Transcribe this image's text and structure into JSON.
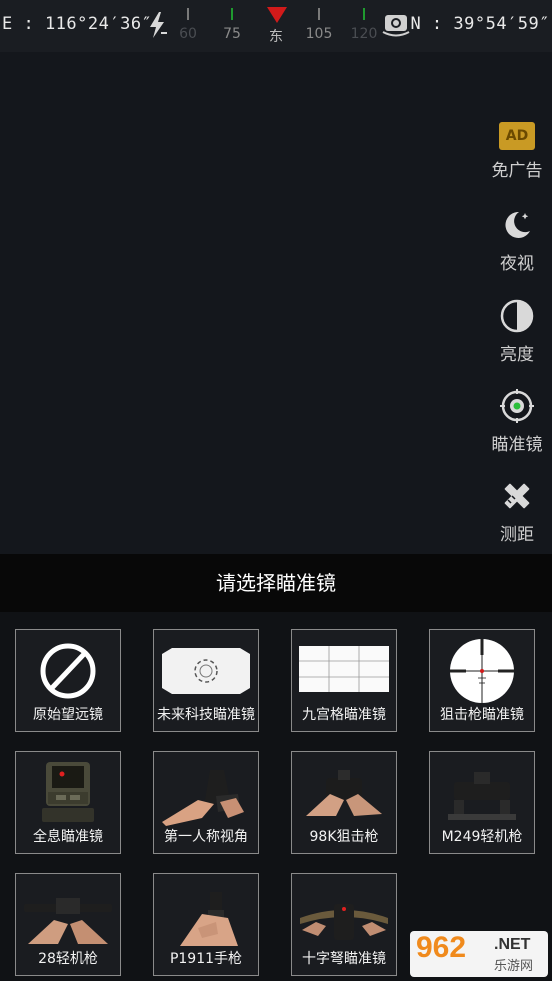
{
  "hud": {
    "longitude": "E : 116°24′36″",
    "latitude": "N : 39°54′59″",
    "compass": {
      "labels": [
        "60",
        "75",
        "东",
        "105",
        "120"
      ],
      "heading_label": "东"
    }
  },
  "sidebar": {
    "items": [
      {
        "label": "免广告",
        "icon": "ad-badge-icon",
        "badge": "AD"
      },
      {
        "label": "夜视",
        "icon": "moon-icon"
      },
      {
        "label": "亮度",
        "icon": "brightness-icon"
      },
      {
        "label": "瞄准镜",
        "icon": "crosshair-icon"
      },
      {
        "label": "测距",
        "icon": "ruler-pencil-icon"
      }
    ]
  },
  "scope_panel": {
    "title": "请选择瞄准镜",
    "options": [
      {
        "label": "原始望远镜",
        "thumb": "no-scope-icon"
      },
      {
        "label": "未来科技瞄准镜",
        "thumb": "futuristic-scope"
      },
      {
        "label": "九宫格瞄准镜",
        "thumb": "grid-scope"
      },
      {
        "label": "狙击枪瞄准镜",
        "thumb": "sniper-scope"
      },
      {
        "label": "全息瞄准镜",
        "thumb": "holographic-sight"
      },
      {
        "label": "第一人称视角",
        "thumb": "first-person-view"
      },
      {
        "label": "98K狙击枪",
        "thumb": "98k-rifle"
      },
      {
        "label": "M249轻机枪",
        "thumb": "m249-lmg"
      },
      {
        "label": "28轻机枪",
        "thumb": "28-lmg"
      },
      {
        "label": "P1911手枪",
        "thumb": "p1911-pistol"
      },
      {
        "label": "十字弩瞄准镜",
        "thumb": "crossbow-scope"
      }
    ]
  },
  "watermark": {
    "number": "962",
    "domain": ".NET",
    "site_name": "乐游网"
  },
  "colors": {
    "background": "#14171c",
    "ad_badge": "#c99a24",
    "compass_marker": "#d11a1a",
    "compass_green": "#1f9a2f",
    "tile_border": "#8a8a8a"
  }
}
